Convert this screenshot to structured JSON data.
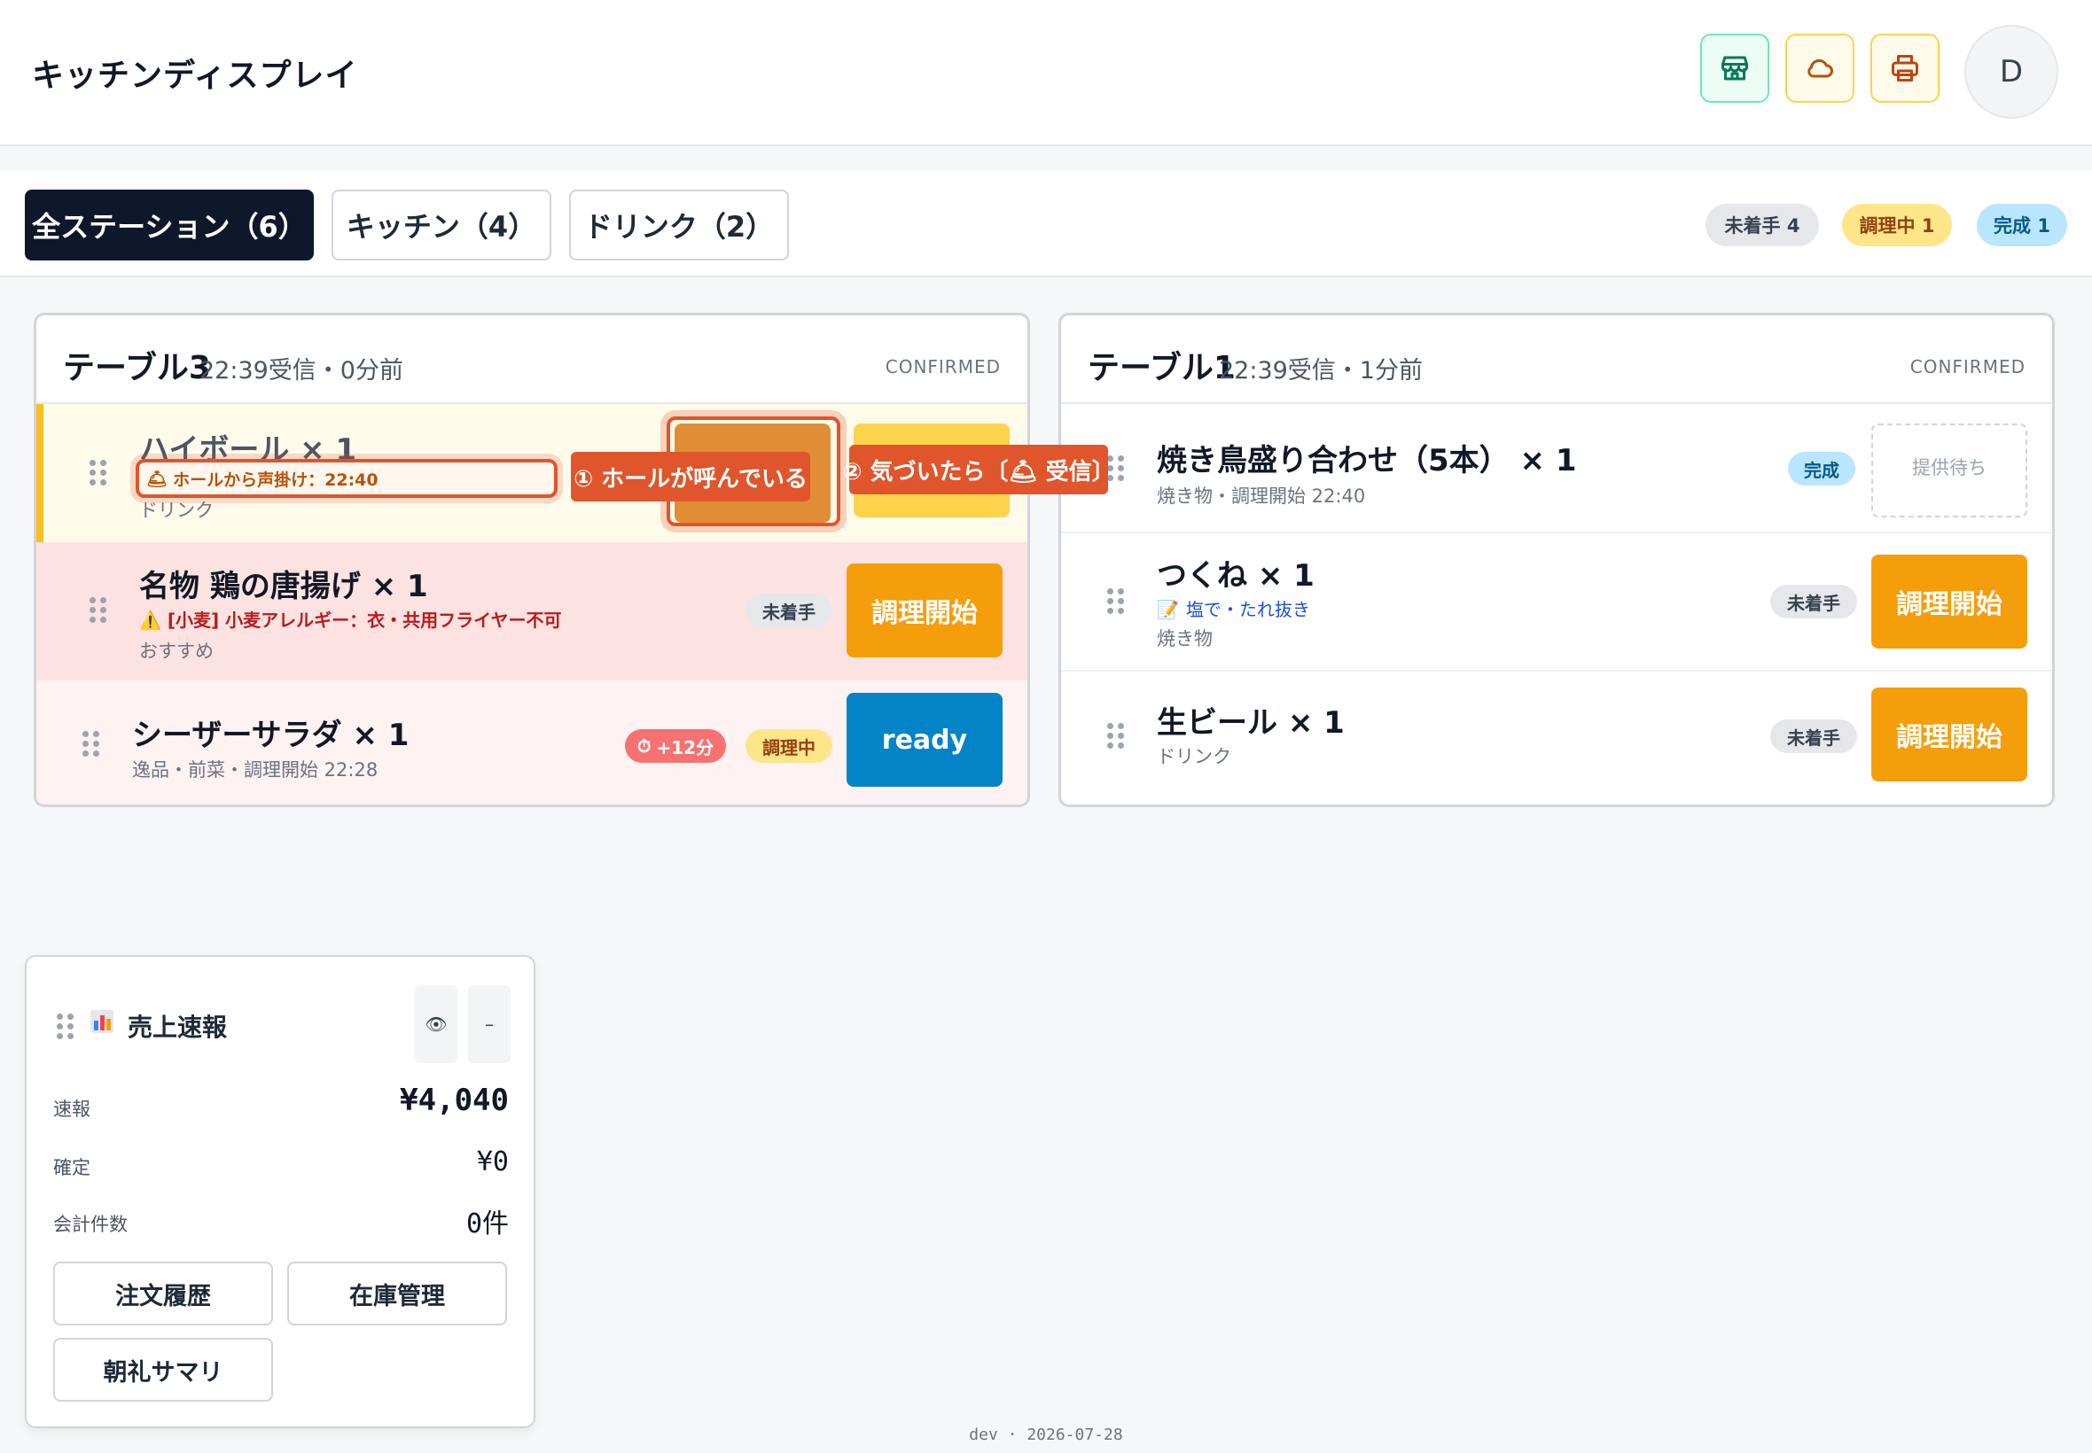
{
  "header": {
    "title": "キッチンディスプレイ",
    "avatar_initial": "D",
    "icons": [
      "store-icon",
      "cloud-icon",
      "printer-icon"
    ]
  },
  "tabs": [
    {
      "label": "全ステーション（6）",
      "active": true
    },
    {
      "label": "キッチン（4）",
      "active": false
    },
    {
      "label": "ドリンク（2）",
      "active": false
    }
  ],
  "summary": {
    "todo": "未着手 4",
    "cooking": "調理中 1",
    "done": "完成 1"
  },
  "orders": [
    {
      "table": "テーブル3",
      "meta": "22:39受信・0分前",
      "status": "CONFIRMED",
      "items": [
        {
          "name": "ハイボール",
          "qty": "× 1",
          "call_text": "ホールから声掛け：22:40",
          "sub": "ドリンク"
        },
        {
          "name": "名物 鶏の唐揚げ",
          "qty": "× 1",
          "allergy": "[小麦] 小麦アレルギー：衣・共用フライヤー不可",
          "sub": "おすすめ",
          "badge": "未着手",
          "action": "調理開始"
        },
        {
          "name": "シーザーサラダ",
          "qty": "× 1",
          "sub": "逸品・前菜・調理開始 22:28",
          "timer": "+12分",
          "badge": "調理中",
          "action": "ready"
        }
      ]
    },
    {
      "table": "テーブル1",
      "meta": "22:39受信・1分前",
      "status": "CONFIRMED",
      "items": [
        {
          "name": "焼き鳥盛り合わせ（5本）",
          "qty": "× 1",
          "sub": "焼き物・調理開始 22:40",
          "badge": "完成",
          "action": "提供待ち"
        },
        {
          "name": "つくね",
          "qty": "× 1",
          "note": "塩で・たれ抜き",
          "sub": "焼き物",
          "badge": "未着手",
          "action": "調理開始"
        },
        {
          "name": "生ビール",
          "qty": "× 1",
          "sub": "ドリンク",
          "badge": "未着手",
          "action": "調理開始"
        }
      ]
    }
  ],
  "callouts": {
    "one": "① ホールが呼んでいる",
    "two": "② 気づいたら〔🛎 受信〕"
  },
  "sales": {
    "title": "売上速報",
    "rows": [
      {
        "label": "速報",
        "value": "¥4,040"
      },
      {
        "label": "確定",
        "value": "¥0"
      },
      {
        "label": "会計件数",
        "value": "0件"
      }
    ],
    "buttons": [
      "注文履歴",
      "在庫管理",
      "朝礼サマリ"
    ],
    "eye": "👁",
    "minimize": "–"
  },
  "footer": "dev · 2026-07-28",
  "colors": {
    "accent_dark": "#0f172a",
    "start": "#f59e0b",
    "ready": "#0284c7",
    "callout": "#e0552b",
    "allergy_bg": "#fde2e2"
  }
}
